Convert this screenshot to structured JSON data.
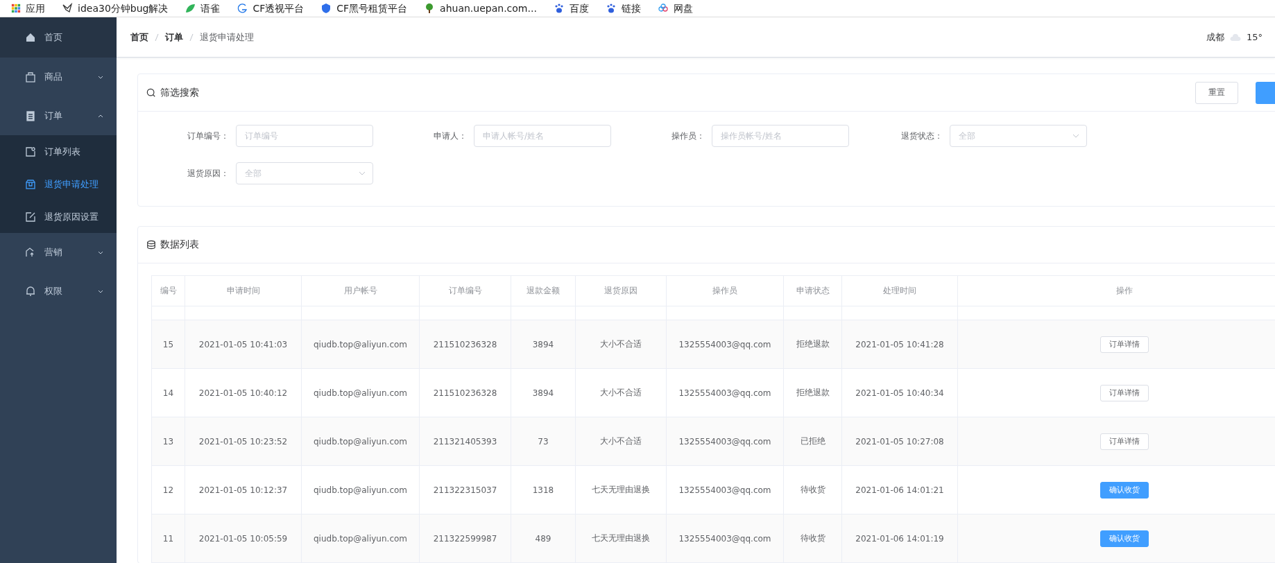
{
  "bookmarks": [
    {
      "label": "应用",
      "kind": "apps"
    },
    {
      "label": "idea30分钟bug解决",
      "kind": "bird"
    },
    {
      "label": "语雀",
      "kind": "leaf"
    },
    {
      "label": "CF透视平台",
      "kind": "swirl"
    },
    {
      "label": "CF黑号租赁平台",
      "kind": "badge"
    },
    {
      "label": "ahuan.uepan.com...",
      "kind": "tree"
    },
    {
      "label": "百度",
      "kind": "paw"
    },
    {
      "label": "链接",
      "kind": "paw"
    },
    {
      "label": "网盘",
      "kind": "cloud"
    }
  ],
  "sidebar": {
    "items": [
      {
        "label": "首页",
        "kind": "home",
        "expandable": false,
        "selected": false
      },
      {
        "label": "商品",
        "kind": "bag",
        "expandable": true,
        "expanded": false,
        "selected": false
      },
      {
        "label": "订单",
        "kind": "clipboard",
        "expandable": true,
        "expanded": true,
        "selected": false,
        "children": [
          {
            "label": "订单列表",
            "kind": "note",
            "selected": false
          },
          {
            "label": "退货申请处理",
            "kind": "box",
            "selected": true
          },
          {
            "label": "退货原因设置",
            "kind": "edit",
            "selected": false
          }
        ]
      },
      {
        "label": "营销",
        "kind": "share",
        "expandable": true,
        "expanded": false,
        "selected": false
      },
      {
        "label": "权限",
        "kind": "bell",
        "expandable": true,
        "expanded": false,
        "selected": false
      }
    ]
  },
  "breadcrumb": [
    {
      "label": "首页",
      "current": false
    },
    {
      "label": "订单",
      "current": false
    },
    {
      "label": "退货申请处理",
      "current": true
    }
  ],
  "weather": {
    "city": "成都",
    "temperature": "15°"
  },
  "filter": {
    "title": "筛选搜索",
    "reset_button": "重置",
    "fields": [
      {
        "label": "订单编号：",
        "kind": "input",
        "placeholder": "订单编号"
      },
      {
        "label": "申请人：",
        "kind": "input",
        "placeholder": "申请人帐号/姓名"
      },
      {
        "label": "操作员：",
        "kind": "input",
        "placeholder": "操作员帐号/姓名"
      },
      {
        "label": "退货状态：",
        "kind": "select",
        "placeholder": "全部"
      },
      {
        "label": "退货原因：",
        "kind": "select",
        "placeholder": "全部"
      }
    ]
  },
  "table": {
    "title": "数据列表",
    "columns": [
      "编号",
      "申请时间",
      "用户帐号",
      "订单编号",
      "退款金额",
      "退货原因",
      "操作员",
      "申请状态",
      "处理时间",
      "操作"
    ],
    "rows": [
      {
        "cells": [
          "15",
          "2021-01-05 10:41:03",
          "qiudb.top@aliyun.com",
          "211510236328",
          "3894",
          "大小不合适",
          "1325554003@qq.com",
          "拒绝退款",
          "2021-01-05 10:41:28"
        ],
        "action": {
          "kind": "detail",
          "label": "订单详情"
        }
      },
      {
        "cells": [
          "14",
          "2021-01-05 10:40:12",
          "qiudb.top@aliyun.com",
          "211510236328",
          "3894",
          "大小不合适",
          "1325554003@qq.com",
          "拒绝退款",
          "2021-01-05 10:40:34"
        ],
        "action": {
          "kind": "detail",
          "label": "订单详情"
        }
      },
      {
        "cells": [
          "13",
          "2021-01-05 10:23:52",
          "qiudb.top@aliyun.com",
          "211321405393",
          "73",
          "大小不合适",
          "1325554003@qq.com",
          "已拒绝",
          "2021-01-05 10:27:08"
        ],
        "action": {
          "kind": "detail",
          "label": "订单详情"
        }
      },
      {
        "cells": [
          "12",
          "2021-01-05 10:12:37",
          "qiudb.top@aliyun.com",
          "211322315037",
          "1318",
          "七天无理由退换",
          "1325554003@qq.com",
          "待收货",
          "2021-01-06 14:01:21"
        ],
        "action": {
          "kind": "confirm",
          "label": "确认收货"
        }
      },
      {
        "cells": [
          "11",
          "2021-01-05 10:05:59",
          "qiudb.top@aliyun.com",
          "211322599987",
          "489",
          "七天无理由退换",
          "1325554003@qq.com",
          "待收货",
          "2021-01-06 14:01:19"
        ],
        "action": {
          "kind": "confirm",
          "label": "确认收货"
        }
      }
    ]
  }
}
